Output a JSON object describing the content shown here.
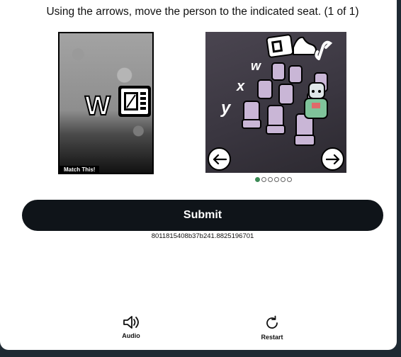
{
  "challenge": {
    "instruction": "Using the arrows, move the person to the indicated seat. (1 of 1)",
    "reference": {
      "seat_letter": "W",
      "caption": "Match This!"
    },
    "scene": {
      "row_labels": [
        "w",
        "x",
        "y"
      ]
    },
    "pagination": {
      "total": 6,
      "active_index": 0
    }
  },
  "actions": {
    "submit_label": "Submit",
    "session_id": "8011815408b37b241.8825196701",
    "audio_label": "Audio",
    "restart_label": "Restart"
  },
  "colors": {
    "submit_bg": "#0f1419",
    "dot_active": "#3d8a56",
    "seat_color": "#c9b6d6"
  }
}
